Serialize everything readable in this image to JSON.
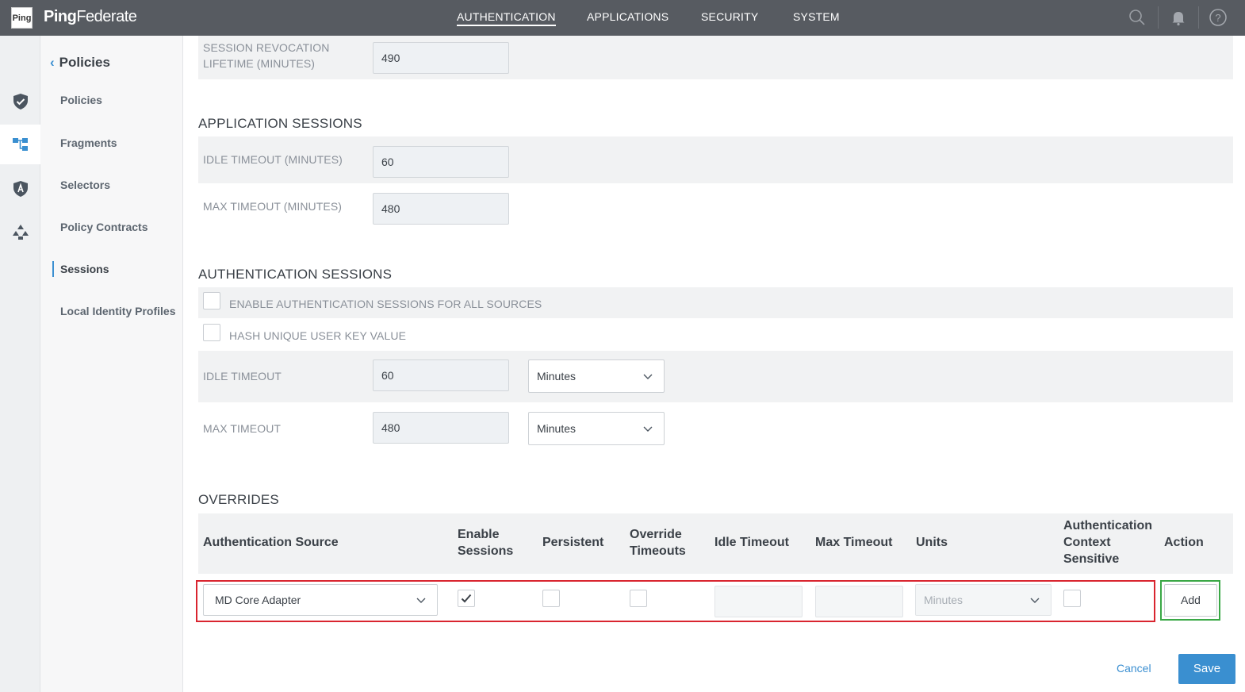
{
  "app": {
    "logo_text": "Ping",
    "brand_a": "Ping",
    "brand_b": "Federate"
  },
  "topnav": {
    "items": [
      {
        "label": "AUTHENTICATION",
        "active": true
      },
      {
        "label": "APPLICATIONS",
        "active": false
      },
      {
        "label": "SECURITY",
        "active": false
      },
      {
        "label": "SYSTEM",
        "active": false
      }
    ],
    "icons": [
      "search-icon",
      "bell-icon",
      "help-icon"
    ]
  },
  "rail": {
    "icons": [
      "shield-check-icon",
      "fragments-icon",
      "selector-shield-icon",
      "policy-contracts-icon"
    ]
  },
  "subnav": {
    "back_title": "Policies",
    "items": [
      {
        "label": "Policies"
      },
      {
        "label": "Fragments"
      },
      {
        "label": "Selectors"
      },
      {
        "label": "Policy Contracts"
      },
      {
        "label": "Sessions",
        "selected": true
      },
      {
        "label": "Local Identity Profiles"
      }
    ]
  },
  "revocation": {
    "label_line1": "SESSION REVOCATION",
    "label_line2": "LIFETIME (MINUTES)",
    "value": "490"
  },
  "application_sessions": {
    "title": "APPLICATION SESSIONS",
    "idle_label": "IDLE TIMEOUT (MINUTES)",
    "idle_value": "60",
    "max_label": "MAX TIMEOUT (MINUTES)",
    "max_value": "480"
  },
  "authentication_sessions": {
    "title": "AUTHENTICATION SESSIONS",
    "enable_all_label": "ENABLE AUTHENTICATION SESSIONS FOR ALL SOURCES",
    "enable_all_checked": false,
    "hash_label": "HASH UNIQUE USER KEY VALUE",
    "hash_checked": false,
    "idle_label": "IDLE TIMEOUT",
    "idle_value": "60",
    "idle_unit": "Minutes",
    "max_label": "MAX TIMEOUT",
    "max_value": "480",
    "max_unit": "Minutes"
  },
  "overrides": {
    "title": "OVERRIDES",
    "columns": {
      "source": "Authentication Source",
      "enable_1": "Enable",
      "enable_2": "Sessions",
      "persistent": "Persistent",
      "override_1": "Override",
      "override_2": "Timeouts",
      "idle": "Idle Timeout",
      "max": "Max Timeout",
      "units": "Units",
      "acs_1": "Authentication",
      "acs_2": "Context",
      "acs_3": "Sensitive",
      "action": "Action"
    },
    "new_row": {
      "source": "MD Core Adapter",
      "enable_sessions": true,
      "persistent": false,
      "override_timeouts": false,
      "idle_value": "",
      "max_value": "",
      "units_placeholder": "Minutes",
      "auth_context_sensitive": false,
      "add_label": "Add"
    }
  },
  "footer": {
    "cancel_label": "Cancel",
    "save_label": "Save"
  },
  "colors": {
    "topbar": "#575b61",
    "accent": "#3a8fd0",
    "highlight_red": "#d9252f",
    "highlight_green": "#3aa846"
  }
}
